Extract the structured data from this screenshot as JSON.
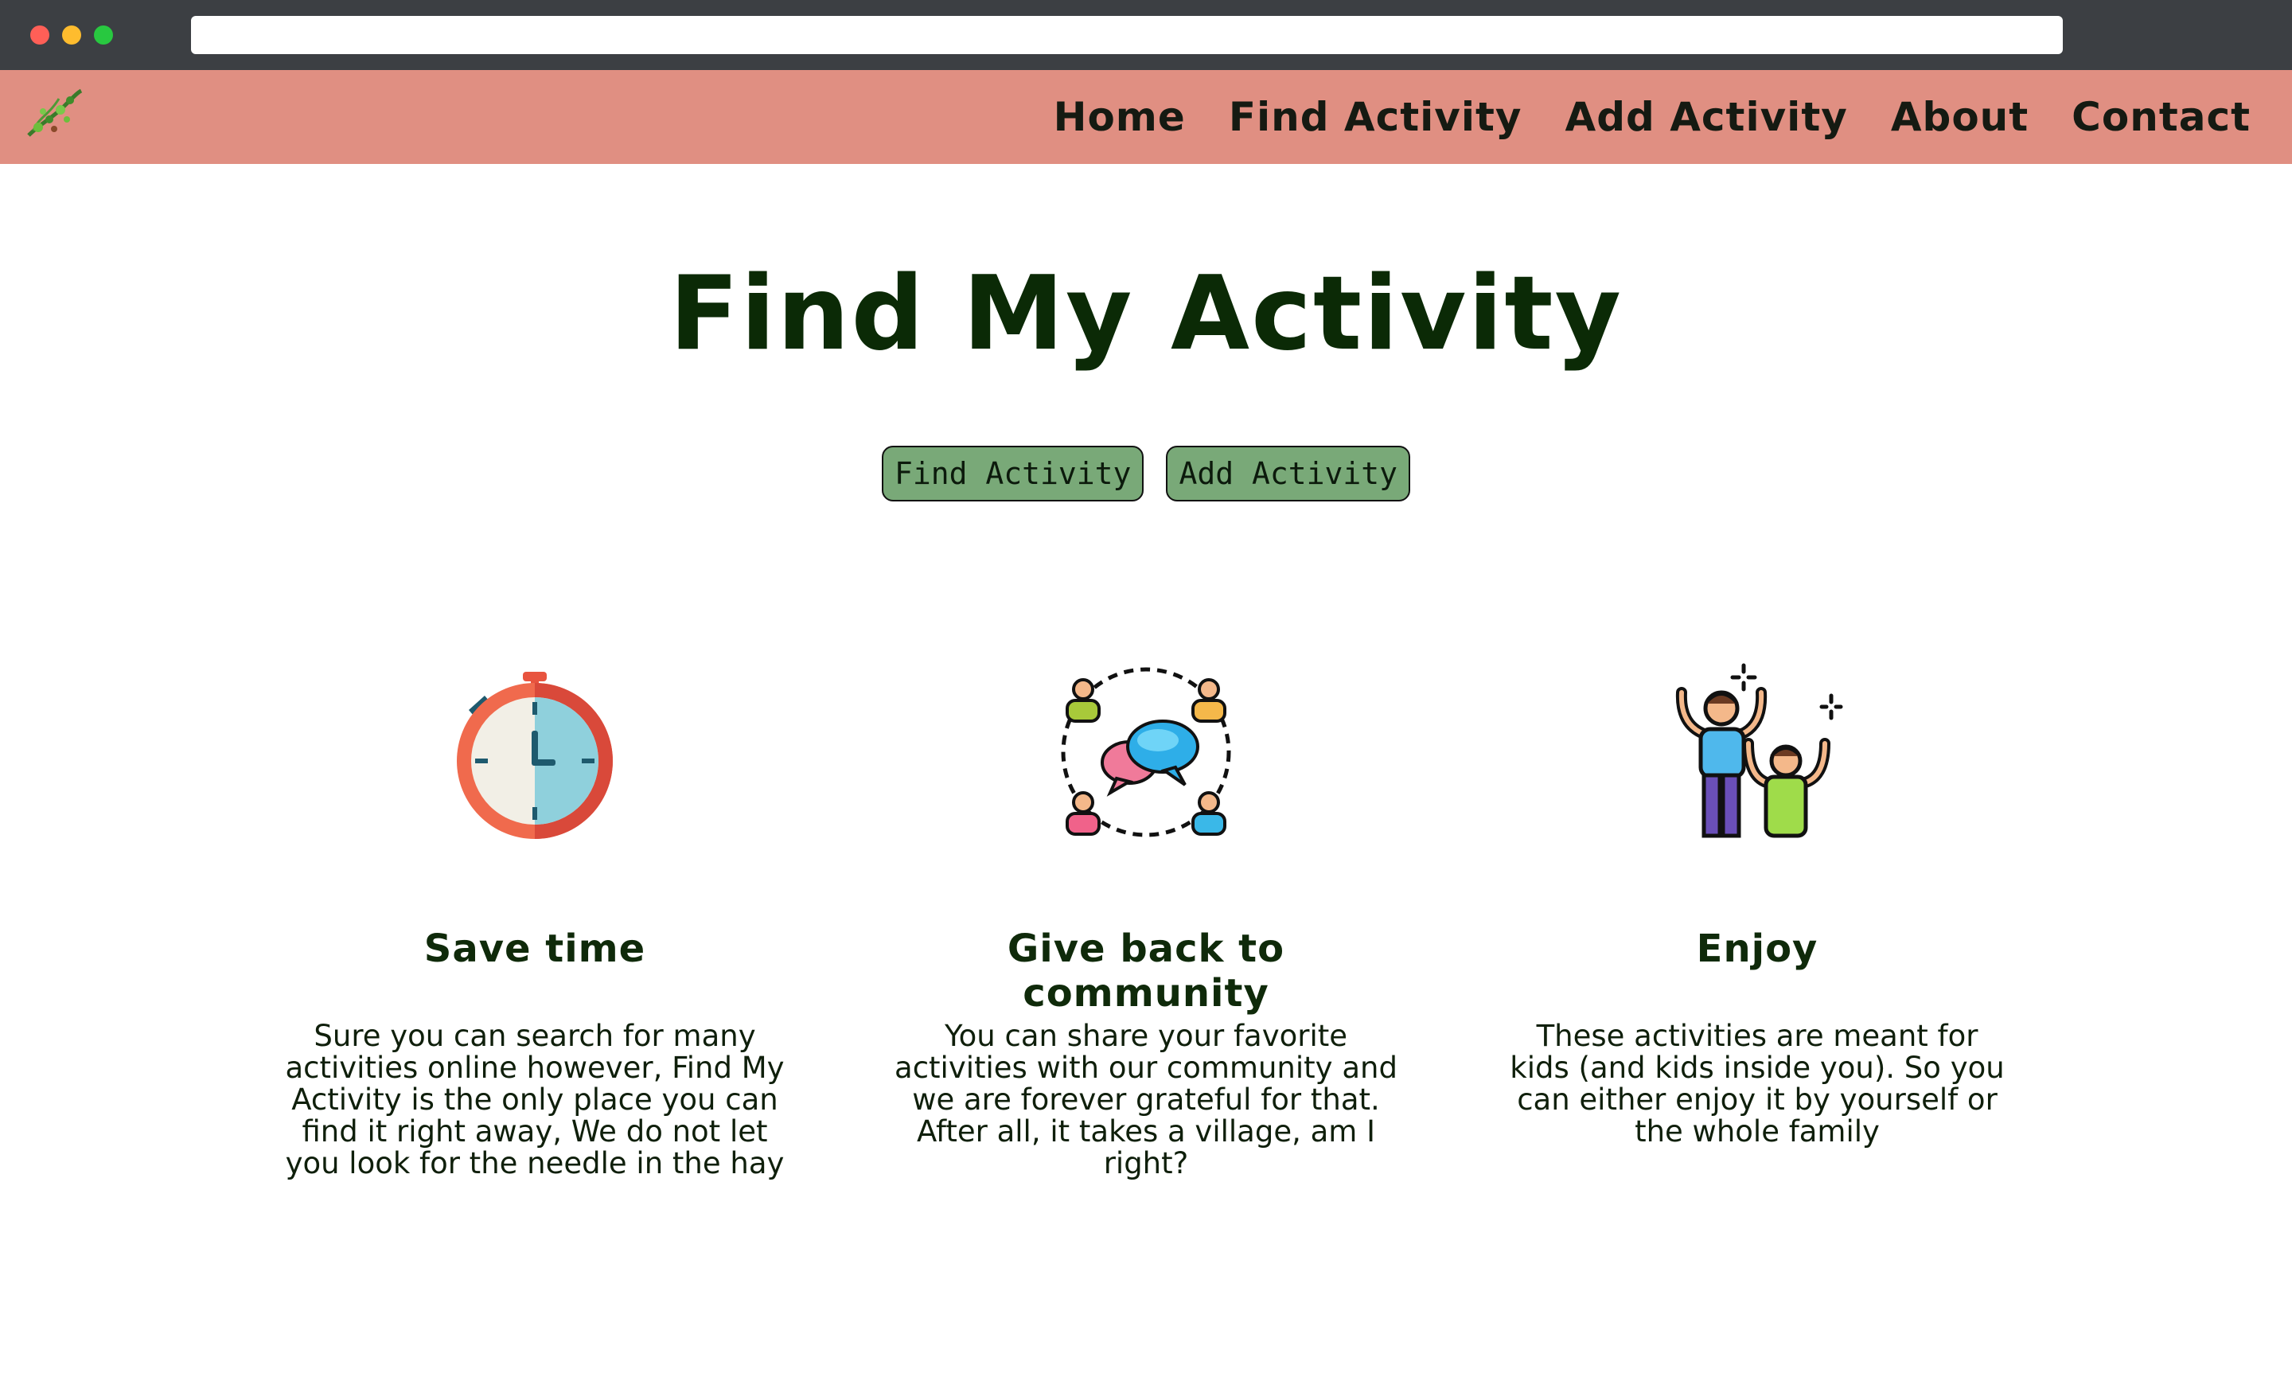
{
  "nav": {
    "logo_icon": "vine-logo-icon",
    "links": [
      "Home",
      "Find Activity",
      "Add Activity",
      "About",
      "Contact"
    ]
  },
  "hero": {
    "title": "Find My Activity",
    "buttons": [
      "Find Activity",
      "Add Activity"
    ]
  },
  "features": [
    {
      "icon": "stopwatch-icon",
      "title": "Save time",
      "text": "Sure you can search for many activities online however, Find My Activity is the only place you can find it right away, We do not let you look for the needle in the hay"
    },
    {
      "icon": "community-chat-icon",
      "title": "Give back to community",
      "text": "You can share your favorite activities with our community and we are forever grateful for that. After all, it takes a village, am I right?"
    },
    {
      "icon": "celebrating-people-icon",
      "title": "Enjoy",
      "text": "These activities are meant for kids (and kids inside you). So you can either enjoy it by yourself or the whole family"
    }
  ],
  "colors": {
    "navbar": "#e08f82",
    "button": "#79a978",
    "title": "#0b2a06"
  }
}
